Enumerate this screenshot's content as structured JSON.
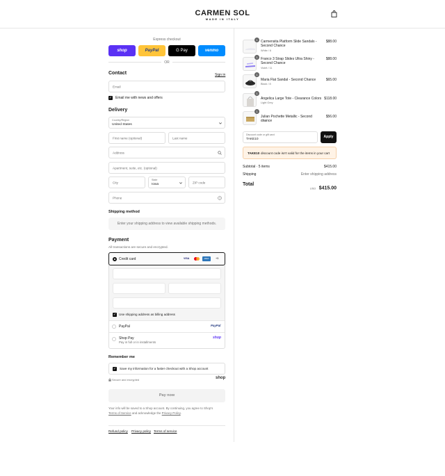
{
  "brand": {
    "name": "CARMEN SOL",
    "tagline": "MADE IN ITALY"
  },
  "express": {
    "label": "Express checkout",
    "or": "OR",
    "buttons": [
      "shop",
      "PayPal",
      "G Pay",
      "venmo"
    ]
  },
  "contact": {
    "title": "Contact",
    "signin": "Sign in",
    "email_placeholder": "Email",
    "news_label": "Email me with news and offers"
  },
  "delivery": {
    "title": "Delivery",
    "country_label": "Country/Region",
    "country_value": "United States",
    "first_name": "First name (optional)",
    "last_name": "Last name",
    "address": "Address",
    "apartment": "Apartment, suite, etc. (optional)",
    "city": "City",
    "state_label": "State",
    "state_value": "Iowa",
    "zip": "ZIP code",
    "phone": "Phone"
  },
  "shipping": {
    "title": "Shipping method",
    "message": "Enter your shipping address to view available shipping methods."
  },
  "payment": {
    "title": "Payment",
    "subtitle": "All transactions are secure and encrypted.",
    "credit_card": "Credit card",
    "card_badges": [
      "VISA",
      "MC",
      "AMEX",
      "+5"
    ],
    "billing_same": "Use shipping address as billing address",
    "paypal": "PayPal",
    "paypal_logo": "PayPal",
    "shoppay": "Shop Pay",
    "shoppay_sub": "Pay in full or in installments",
    "shoppay_logo": "shop"
  },
  "remember": {
    "title": "Remember me",
    "label": "Save my information for a faster checkout with a Shop account",
    "secure": "Secure and encrypted",
    "shop_logo": "shop"
  },
  "pay_now": "Pay now",
  "legal": {
    "line1": "Your info will be saved to a Shop account. By continuing, you agree to Shop's",
    "terms": "Terms of Service",
    "mid": "and acknowledge the",
    "privacy": "Privacy Policy",
    "end": "."
  },
  "footer_links": [
    "Refund policy",
    "Privacy policy",
    "Terms of service"
  ],
  "cart": {
    "items": [
      {
        "qty": "1",
        "name": "Carmensita Platform Slide Sandals - Second Chance",
        "variant": "White / 6",
        "price": "$88.00"
      },
      {
        "qty": "1",
        "name": "Franco 3 Strap Slides Ultra Shiny - Second Chance",
        "variant": "Violet / 11",
        "price": "$88.00"
      },
      {
        "qty": "1",
        "name": "Maria Flat Sandal - Second Chance",
        "variant": "Black / 8",
        "price": "$65.00"
      },
      {
        "qty": "1",
        "name": "Angelica Large Tote - Clearance Colors",
        "variant": "Light Grey",
        "price": "$118.00"
      },
      {
        "qty": "1",
        "name": "Julian Pochette Metallic - Second chance",
        "variant": "Gold",
        "price": "$56.00"
      }
    ],
    "discount_label": "Discount code or gift card",
    "discount_value": "TAKE10",
    "apply": "Apply",
    "warning_code": "TAKE10",
    "warning_text": "discount code isn't valid for the items in your cart",
    "subtotal_label": "Subtotal · 5 items",
    "subtotal_value": "$415.00",
    "shipping_label": "Shipping",
    "shipping_value": "Enter shipping address",
    "total_label": "Total",
    "total_currency": "USD",
    "total_value": "$415.00"
  },
  "colors": {
    "shop": "#5a31f4",
    "paypal": "#ffc439",
    "gpay": "#000000",
    "venmo": "#008cff"
  }
}
